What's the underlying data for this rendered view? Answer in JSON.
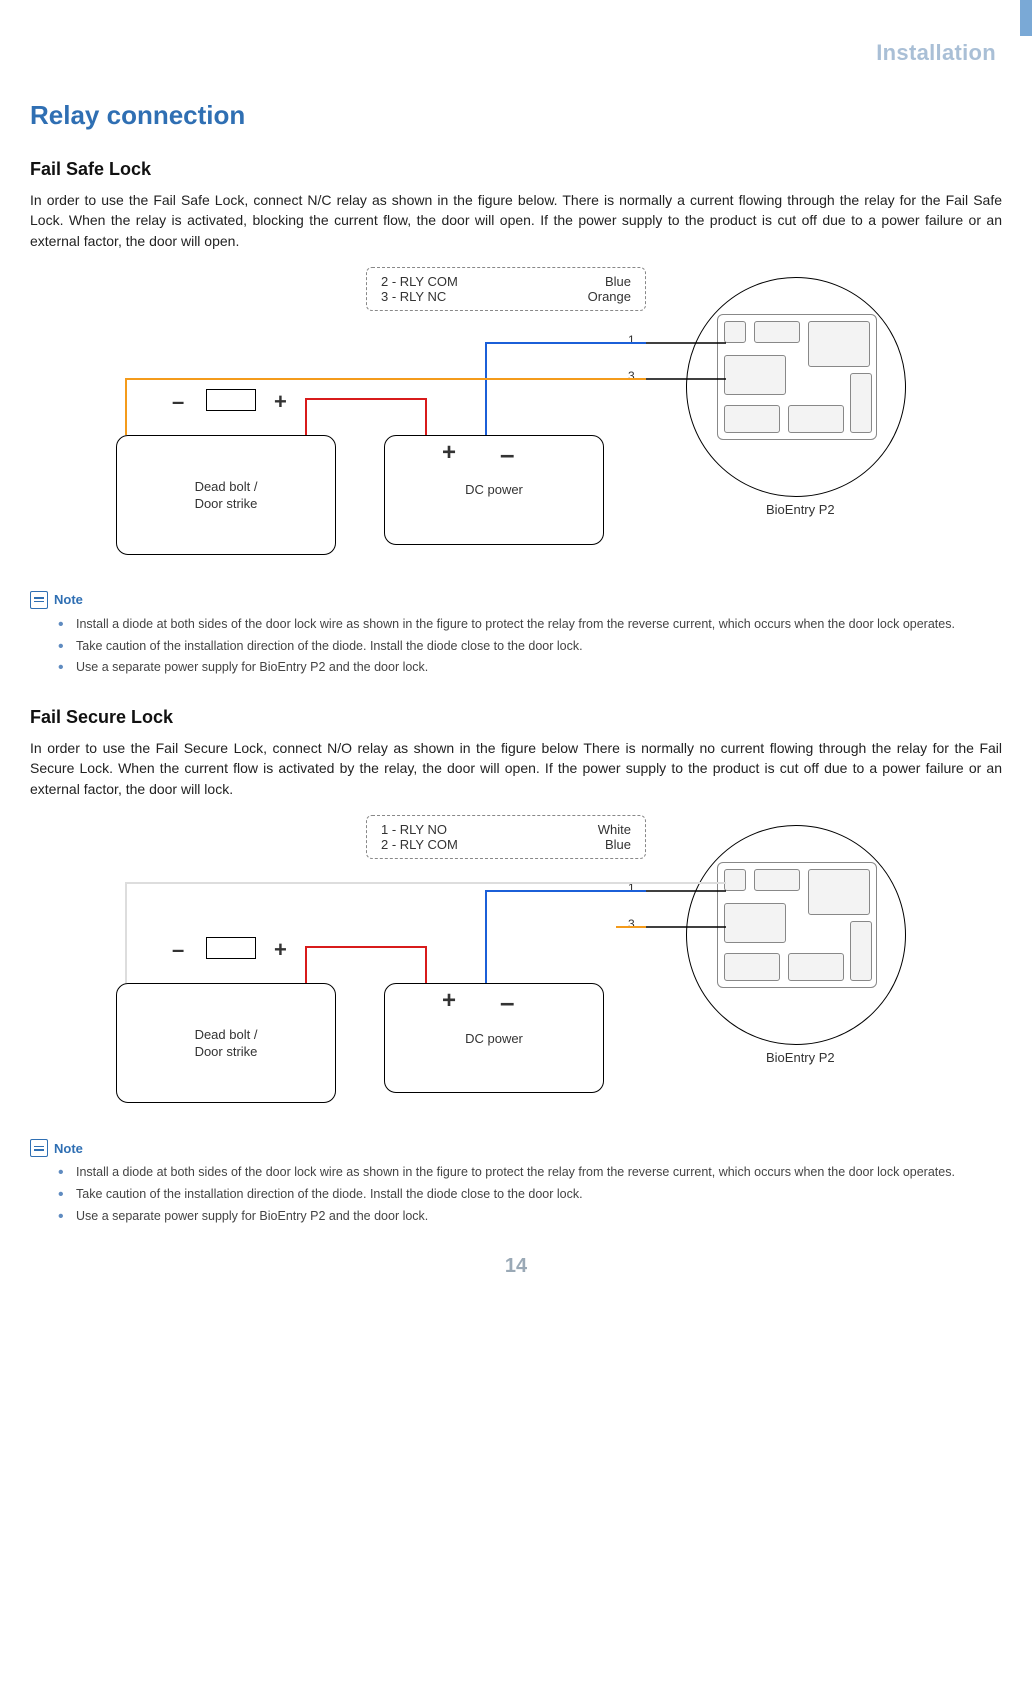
{
  "header": {
    "section": "Installation"
  },
  "page_title": "Relay connection",
  "sections": {
    "fail_safe": {
      "title": "Fail Safe Lock",
      "body": "In order to use the Fail Safe Lock, connect N/C relay as shown in the figure below. There is normally a current flowing through the relay for the Fail Safe Lock. When the relay is activated, blocking the current flow, the door will open. If the power supply to the product is cut off due to a power failure or an external factor, the door will open.",
      "legend": {
        "rows": [
          {
            "left": "2 -  RLY  COM",
            "right": "Blue"
          },
          {
            "left": "3 -  RLY  NC",
            "right": "Orange"
          }
        ]
      },
      "labels": {
        "deadbolt_line1": "Dead  bolt  /",
        "deadbolt_line2": "Door  strike",
        "dc_power": "DC  power",
        "device": "BioEntry  P2",
        "n1": "1",
        "n3": "3"
      }
    },
    "fail_secure": {
      "title": "Fail Secure Lock",
      "body": "In order to use the Fail Secure Lock, connect N/O relay as shown in the figure below There is normally no current flowing through the relay for the Fail Secure Lock. When the current flow is activated by the relay, the door will open. If the power supply to the product is cut off due to a power failure or an external factor, the door will lock.",
      "legend": {
        "rows": [
          {
            "left": "1 -  RLY  NO",
            "right": "White"
          },
          {
            "left": "2 -  RLY  COM",
            "right": "Blue"
          }
        ]
      },
      "labels": {
        "deadbolt_line1": "Dead  bolt  /",
        "deadbolt_line2": "Door  strike",
        "dc_power": "DC  power",
        "device": "BioEntry  P2",
        "n1": "1",
        "n3": "3"
      }
    }
  },
  "notes": {
    "label": "Note",
    "items": [
      "Install a diode at both sides of the door lock wire as shown in the figure to protect the relay from the reverse current, which occurs when the door lock operates.",
      "Take caution of the installation direction of the diode. Install the diode close to the door lock.",
      "Use a separate power supply for BioEntry P2 and the door lock."
    ]
  },
  "page_number": "14"
}
